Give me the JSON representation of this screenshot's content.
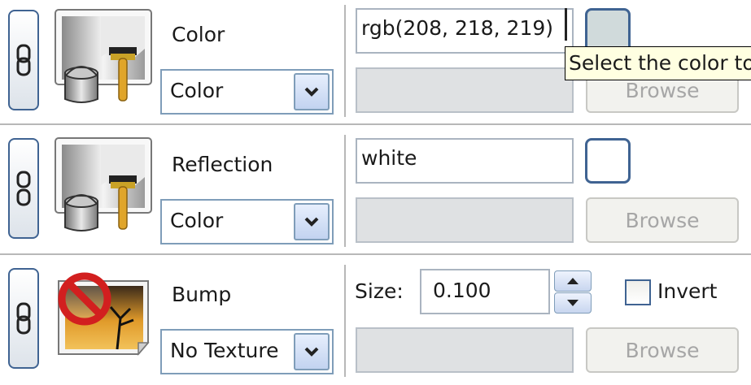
{
  "rows": [
    {
      "label": "Color",
      "select_value": "Color",
      "value": "rgb(208, 218, 219)",
      "swatch_color": "#d0dadb",
      "browse_label": "Browse",
      "tooltip": "Select the color to"
    },
    {
      "label": "Reflection",
      "select_value": "Color",
      "value": "white",
      "swatch_color": "#ffffff",
      "browse_label": "Browse"
    },
    {
      "label": "Bump",
      "select_value": "No Texture",
      "size_label": "Size:",
      "size_value": "0.100",
      "invert_label": "Invert",
      "invert_checked": false,
      "browse_label": "Browse"
    }
  ],
  "icons": {
    "link": "chain-link-icon",
    "unlink": "broken-chain-icon",
    "paint": "paint-bucket-brush-icon",
    "no_texture": "no-texture-icon",
    "dropdown": "chevron-down-icon",
    "spin_up": "spin-up-icon",
    "spin_down": "spin-down-icon"
  }
}
